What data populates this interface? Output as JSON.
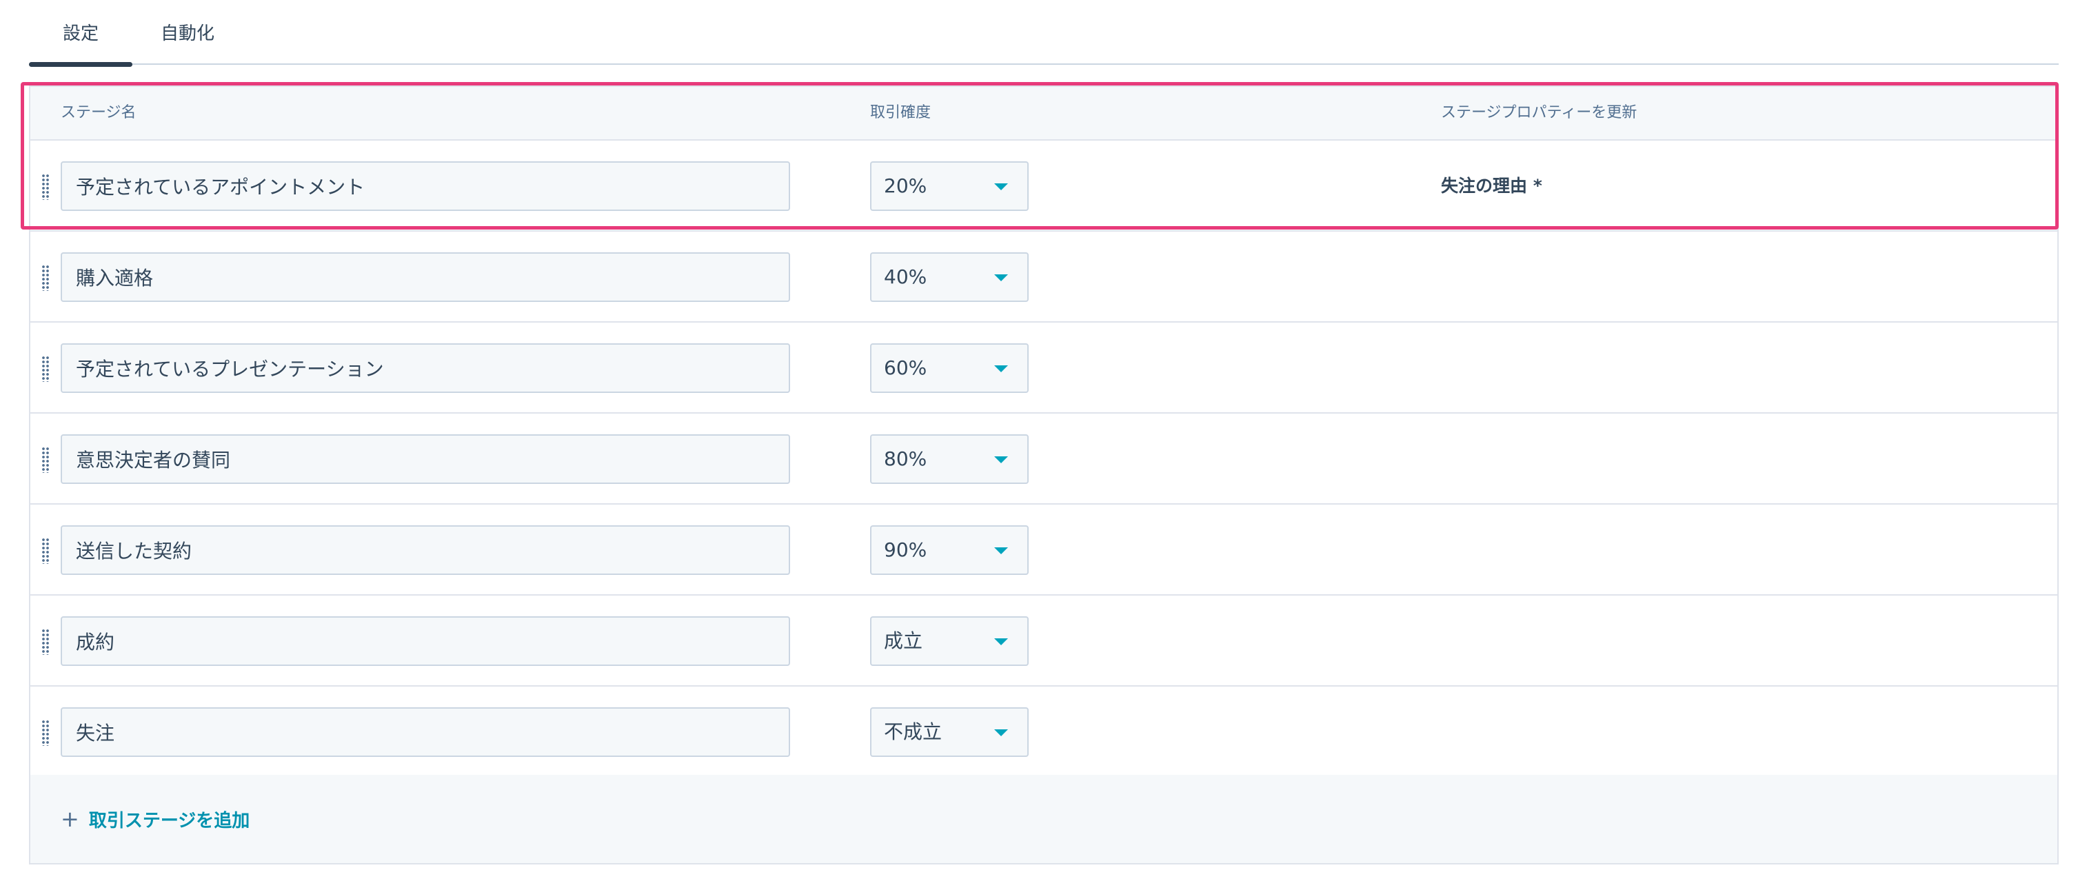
{
  "tabs": {
    "settings": "設定",
    "automation": "自動化",
    "active": "settings"
  },
  "table": {
    "headers": {
      "stage_name": "ステージ名",
      "probability": "取引確度",
      "update_property": "ステージプロパティーを更新"
    },
    "rows": [
      {
        "name": "予定されているアポイントメント",
        "probability": "20%",
        "property": "失注の理由 *"
      },
      {
        "name": "購入適格",
        "probability": "40%",
        "property": ""
      },
      {
        "name": "予定されているプレゼンテーション",
        "probability": "60%",
        "property": ""
      },
      {
        "name": "意思決定者の賛同",
        "probability": "80%",
        "property": ""
      },
      {
        "name": "送信した契約",
        "probability": "90%",
        "property": ""
      },
      {
        "name": "成約",
        "probability": "成立",
        "property": ""
      },
      {
        "name": "失注",
        "probability": "不成立",
        "property": ""
      }
    ]
  },
  "footer": {
    "add_stage_label": "取引ステージを追加",
    "plus_icon": "plus-icon"
  },
  "colors": {
    "accent": "#00a4bd",
    "link": "#0091ae",
    "highlight": "#e83a7a",
    "text": "#33475b"
  }
}
